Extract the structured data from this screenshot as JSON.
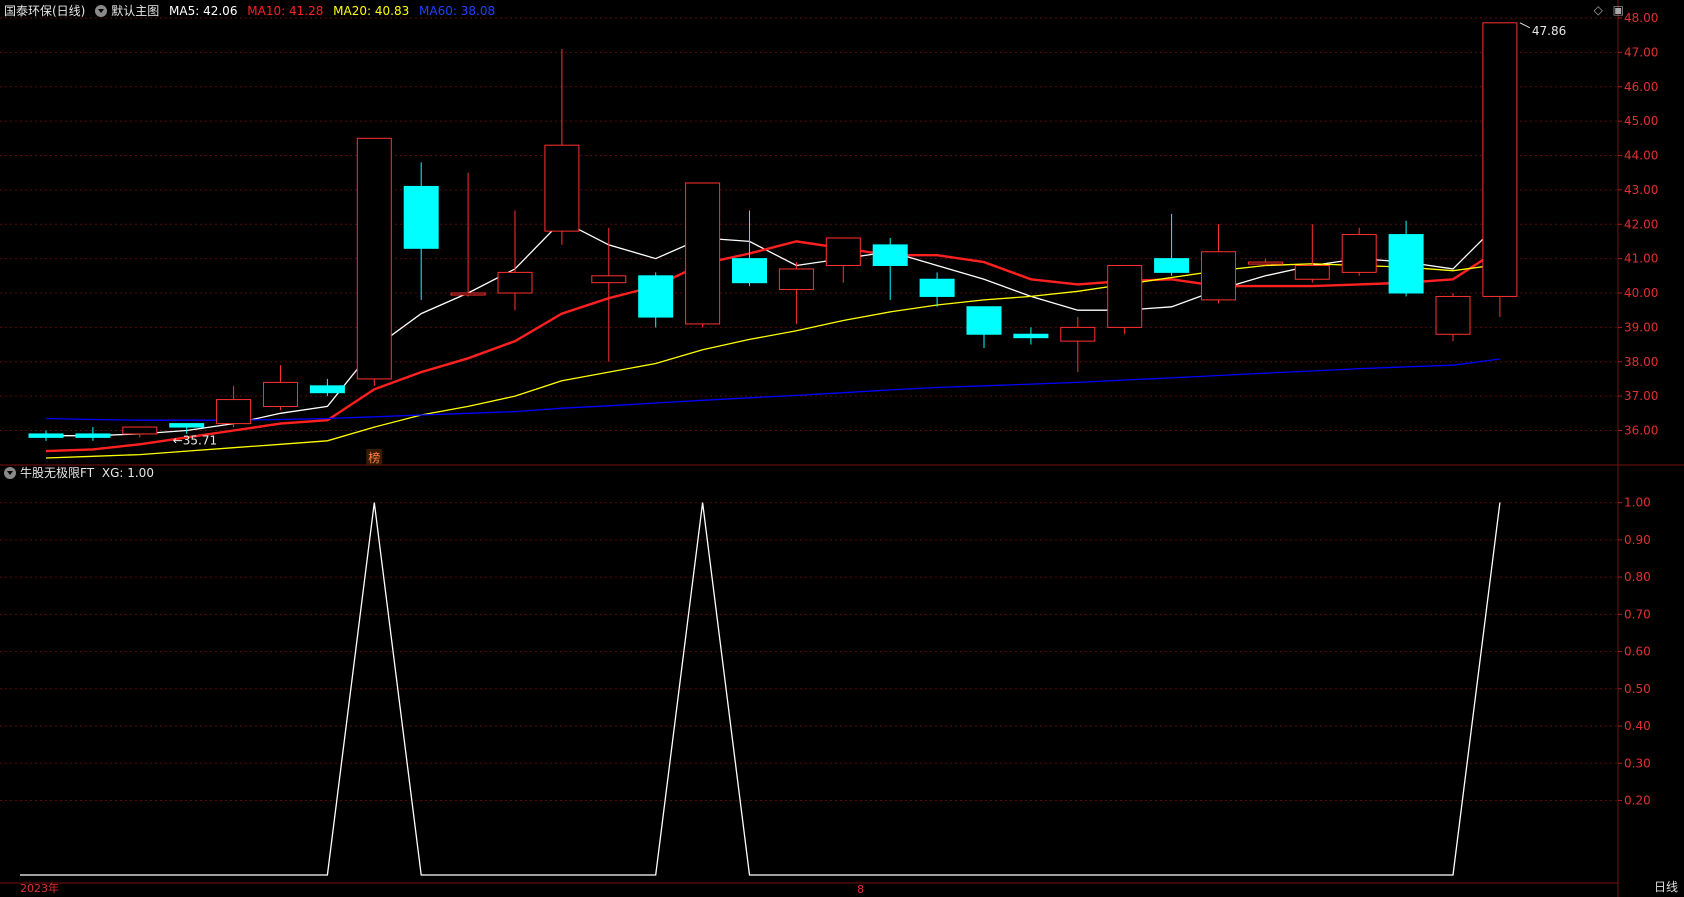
{
  "main_panel": {
    "stock": "国泰环保(日线)",
    "template": "默认主图",
    "ma": [
      {
        "label": "MA5: 42.06",
        "color": "#ffffff"
      },
      {
        "label": "MA10: 41.28",
        "color": "#ff2020"
      },
      {
        "label": "MA20: 40.83",
        "color": "#ffff00"
      },
      {
        "label": "MA60: 38.08",
        "color": "#0000ff"
      }
    ]
  },
  "indicator_panel": {
    "name": "牛股无极限FT",
    "value_label": "XG: 1.00"
  },
  "dates": {
    "year": "2023年",
    "month": "8"
  },
  "period_label": "日线",
  "marker_label": "榜",
  "up_color": "#ff3030",
  "down_color": "#00ffff",
  "chart_data": [
    {
      "type": "candlestick",
      "ylim": [
        35.2,
        48.0
      ],
      "y_ticks": [
        "36.00",
        "37.00",
        "38.00",
        "39.00",
        "40.00",
        "41.00",
        "42.00",
        "43.00",
        "44.00",
        "45.00",
        "46.00",
        "47.00",
        "48.00"
      ],
      "annotations": {
        "high": "47.86",
        "low": "35.71"
      },
      "candles": [
        {
          "o": 35.9,
          "c": 35.8,
          "h": 36.0,
          "l": 35.7
        },
        {
          "o": 35.9,
          "c": 35.8,
          "h": 36.1,
          "l": 35.7
        },
        {
          "o": 35.9,
          "c": 36.1,
          "h": 36.1,
          "l": 35.8
        },
        {
          "o": 36.2,
          "c": 36.1,
          "h": 36.2,
          "l": 35.9
        },
        {
          "o": 36.2,
          "c": 36.9,
          "h": 37.3,
          "l": 36.1
        },
        {
          "o": 36.7,
          "c": 37.4,
          "h": 37.9,
          "l": 36.6
        },
        {
          "o": 37.3,
          "c": 37.1,
          "h": 37.5,
          "l": 37.0
        },
        {
          "o": 37.5,
          "c": 44.5,
          "h": 44.5,
          "l": 37.3
        },
        {
          "o": 43.1,
          "c": 41.3,
          "h": 43.8,
          "l": 39.8
        },
        {
          "o": 40.0,
          "c": 40.0,
          "h": 43.5,
          "l": 39.9
        },
        {
          "o": 40.0,
          "c": 40.6,
          "h": 42.4,
          "l": 39.5
        },
        {
          "o": 41.8,
          "c": 44.3,
          "h": 47.1,
          "l": 41.4
        },
        {
          "o": 40.3,
          "c": 40.5,
          "h": 41.9,
          "l": 38.0
        },
        {
          "o": 40.5,
          "c": 39.3,
          "h": 40.6,
          "l": 39.0
        },
        {
          "o": 39.1,
          "c": 43.2,
          "h": 43.2,
          "l": 39.0
        },
        {
          "o": 41.0,
          "c": 40.3,
          "h": 42.4,
          "l": 40.2
        },
        {
          "o": 40.1,
          "c": 40.7,
          "h": 40.9,
          "l": 39.1
        },
        {
          "o": 40.8,
          "c": 41.6,
          "h": 41.6,
          "l": 40.3
        },
        {
          "o": 41.4,
          "c": 40.8,
          "h": 41.6,
          "l": 39.8
        },
        {
          "o": 40.4,
          "c": 39.9,
          "h": 40.6,
          "l": 39.6
        },
        {
          "o": 39.6,
          "c": 38.8,
          "h": 39.6,
          "l": 38.4
        },
        {
          "o": 38.8,
          "c": 38.7,
          "h": 39.0,
          "l": 38.5
        },
        {
          "o": 38.6,
          "c": 39.0,
          "h": 39.3,
          "l": 37.7
        },
        {
          "o": 39.0,
          "c": 40.8,
          "h": 40.8,
          "l": 38.8
        },
        {
          "o": 41.0,
          "c": 40.6,
          "h": 42.3,
          "l": 40.5
        },
        {
          "o": 39.8,
          "c": 41.2,
          "h": 42.0,
          "l": 39.7
        },
        {
          "o": 40.9,
          "c": 40.9,
          "h": 41.0,
          "l": 40.8
        },
        {
          "o": 40.4,
          "c": 40.8,
          "h": 42.0,
          "l": 40.3
        },
        {
          "o": 40.6,
          "c": 41.7,
          "h": 41.9,
          "l": 40.5
        },
        {
          "o": 41.7,
          "c": 40.0,
          "h": 42.1,
          "l": 39.9
        },
        {
          "o": 38.8,
          "c": 39.9,
          "h": 40.0,
          "l": 38.6
        },
        {
          "o": 39.9,
          "c": 47.86,
          "h": 47.86,
          "l": 39.3
        }
      ],
      "series": [
        {
          "name": "MA5",
          "color": "#ffffff",
          "values": [
            35.85,
            35.85,
            35.9,
            36.0,
            36.2,
            36.5,
            36.7,
            38.4,
            39.4,
            40.0,
            40.7,
            42.1,
            41.4,
            41.0,
            41.6,
            41.5,
            40.8,
            41.0,
            41.2,
            40.8,
            40.4,
            39.9,
            39.5,
            39.5,
            39.6,
            40.1,
            40.5,
            40.8,
            41.0,
            40.9,
            40.7,
            42.06
          ]
        },
        {
          "name": "MA10",
          "color": "#ff2020",
          "values": [
            35.4,
            35.45,
            35.6,
            35.8,
            36.0,
            36.2,
            36.3,
            37.2,
            37.7,
            38.1,
            38.6,
            39.4,
            39.85,
            40.2,
            40.85,
            41.15,
            41.5,
            41.3,
            41.1,
            41.1,
            40.9,
            40.4,
            40.25,
            40.35,
            40.4,
            40.2,
            40.2,
            40.2,
            40.25,
            40.3,
            40.4,
            41.28
          ]
        },
        {
          "name": "MA20",
          "color": "#ffff00",
          "values": [
            35.2,
            35.25,
            35.3,
            35.4,
            35.5,
            35.6,
            35.7,
            36.1,
            36.45,
            36.7,
            37.0,
            37.45,
            37.7,
            37.95,
            38.35,
            38.65,
            38.9,
            39.2,
            39.45,
            39.65,
            39.8,
            39.9,
            40.05,
            40.25,
            40.45,
            40.65,
            40.8,
            40.85,
            40.8,
            40.75,
            40.65,
            40.83
          ]
        },
        {
          "name": "MA60",
          "color": "#0000ff",
          "values": [
            36.35,
            36.32,
            36.3,
            36.3,
            36.3,
            36.32,
            36.35,
            36.4,
            36.45,
            36.5,
            36.55,
            36.65,
            36.72,
            36.8,
            36.88,
            36.95,
            37.02,
            37.1,
            37.18,
            37.25,
            37.3,
            37.35,
            37.4,
            37.47,
            37.53,
            37.6,
            37.67,
            37.73,
            37.8,
            37.85,
            37.9,
            38.08
          ]
        }
      ]
    },
    {
      "type": "line",
      "ylim": [
        0.0,
        1.05
      ],
      "y_ticks": [
        "0.20",
        "0.30",
        "0.40",
        "0.50",
        "0.60",
        "0.70",
        "0.80",
        "0.90",
        "1.00"
      ],
      "series": [
        {
          "name": "XG",
          "color": "#ffffff",
          "values": [
            0,
            0,
            0,
            0,
            0,
            0,
            0,
            1,
            0,
            0,
            0,
            0,
            0,
            0,
            1,
            0,
            0,
            0,
            0,
            0,
            0,
            0,
            0,
            0,
            0,
            0,
            0,
            0,
            0,
            0,
            0,
            1
          ]
        }
      ]
    }
  ]
}
